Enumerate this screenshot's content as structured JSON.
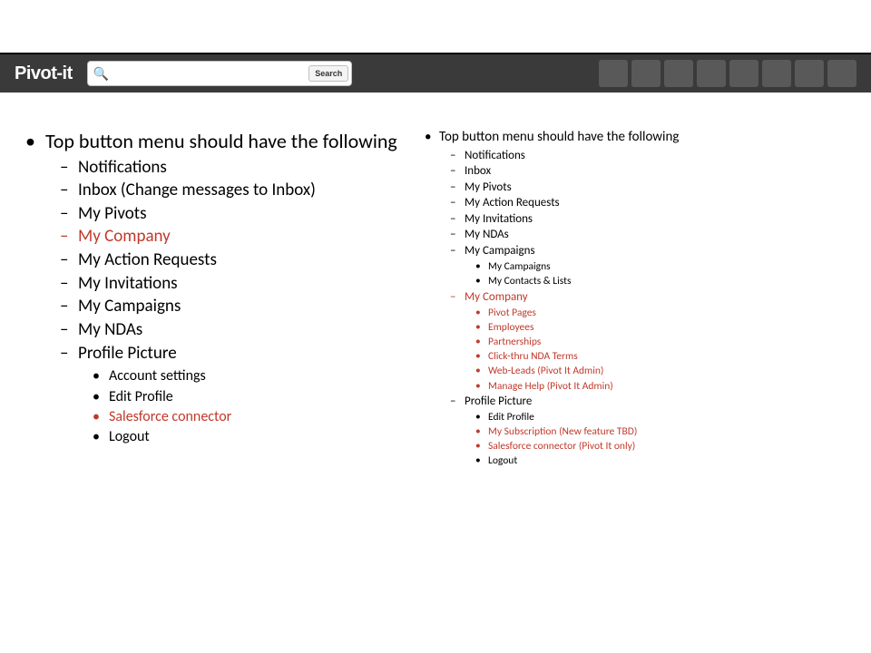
{
  "navbar": {
    "brand": "Pivot-it",
    "search_placeholder": "",
    "search_button": "Search",
    "tile_count": 8
  },
  "left": {
    "title": "Top button menu should have the following",
    "items": [
      {
        "text": "Notifications",
        "red": false
      },
      {
        "text": "Inbox (Change messages to Inbox)",
        "red": false
      },
      {
        "text": "My Pivots",
        "red": false
      },
      {
        "text": "My Company",
        "red": true
      },
      {
        "text": "My Action Requests",
        "red": false
      },
      {
        "text": "My Invitations",
        "red": false
      },
      {
        "text": "My Campaigns",
        "red": false
      },
      {
        "text": "My NDAs",
        "red": false
      },
      {
        "text": "Profile Picture",
        "red": false,
        "children": [
          {
            "text": "Account settings",
            "red": false
          },
          {
            "text": "Edit Profile",
            "red": false
          },
          {
            "text": "Salesforce connector",
            "red": true
          },
          {
            "text": "Logout",
            "red": false
          }
        ]
      }
    ]
  },
  "right": {
    "title": "Top button menu should have the following",
    "items": [
      {
        "text": "Notifications",
        "red": false
      },
      {
        "text": "Inbox",
        "red": false
      },
      {
        "text": "My Pivots",
        "red": false
      },
      {
        "text": "My Action Requests",
        "red": false
      },
      {
        "text": "My Invitations",
        "red": false
      },
      {
        "text": "My NDAs",
        "red": false
      },
      {
        "text": "My Campaigns",
        "red": false,
        "children": [
          {
            "text": "My Campaigns",
            "red": false
          },
          {
            "text": "My Contacts & Lists",
            "red": false
          }
        ]
      },
      {
        "text": "My Company",
        "red": true,
        "children": [
          {
            "text": "Pivot Pages",
            "red": true
          },
          {
            "text": "Employees",
            "red": true
          },
          {
            "text": "Partnerships",
            "red": true
          },
          {
            "text": "Click-thru NDA Terms",
            "red": true
          },
          {
            "text": "Web-Leads (Pivot It Admin)",
            "red": true
          },
          {
            "text": "Manage Help (Pivot It Admin)",
            "red": true
          }
        ]
      },
      {
        "text": "Profile Picture",
        "red": false,
        "children": [
          {
            "text": "Edit Profile",
            "red": false
          },
          {
            "text": "My Subscription (New feature TBD)",
            "red": true
          },
          {
            "text": "Salesforce connector (Pivot It only)",
            "red": true
          },
          {
            "text": "Logout",
            "red": false
          }
        ]
      }
    ]
  }
}
